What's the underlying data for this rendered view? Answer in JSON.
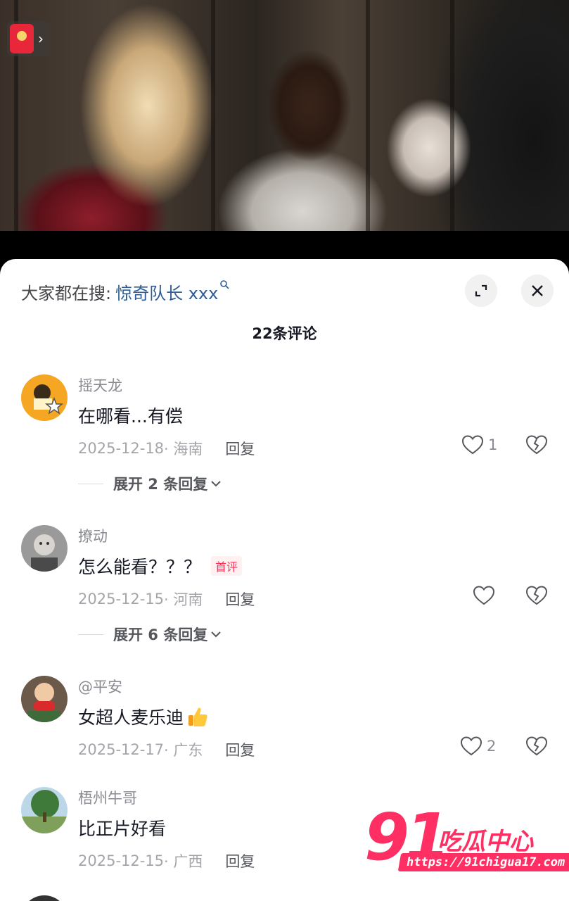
{
  "video": {
    "redpacket_icon": "red-packet-icon",
    "arrow_icon": "chevron-right-icon"
  },
  "sheet": {
    "search_prefix": "大家都在搜:",
    "search_term": "惊奇队长 xxx",
    "search_icon": "search-icon",
    "expand_icon": "expand-icon",
    "close_icon": "close-icon",
    "comment_count": "22条评论"
  },
  "comments": [
    {
      "username": "摇天龙",
      "text": "在哪看...有偿",
      "date": "2025-12-18",
      "location": "· 海南",
      "reply": "回复",
      "likes": "1",
      "expand_replies": "展开 2 条回复"
    },
    {
      "username": "撩动",
      "text": "怎么能看？？？",
      "badge": "首评",
      "date": "2025-12-15",
      "location": "· 河南",
      "reply": "回复",
      "likes": "",
      "expand_replies": "展开 6 条回复"
    },
    {
      "username": "@平安",
      "text": "女超人麦乐迪",
      "emoji": "thumbs-up-emoji",
      "date": "2025-12-17",
      "location": "· 广东",
      "reply": "回复",
      "likes": "2"
    },
    {
      "username": "梧州牛哥",
      "text": "比正片好看",
      "date": "2025-12-15",
      "location": "· 广西",
      "reply": "回复"
    }
  ],
  "watermark": {
    "number": "91",
    "brand": "吃瓜中心",
    "url": "https://91chigua17.com"
  },
  "colors": {
    "search_link": "#2d5c96",
    "badge": "#fe2c55",
    "watermark": "#ff2e63"
  }
}
